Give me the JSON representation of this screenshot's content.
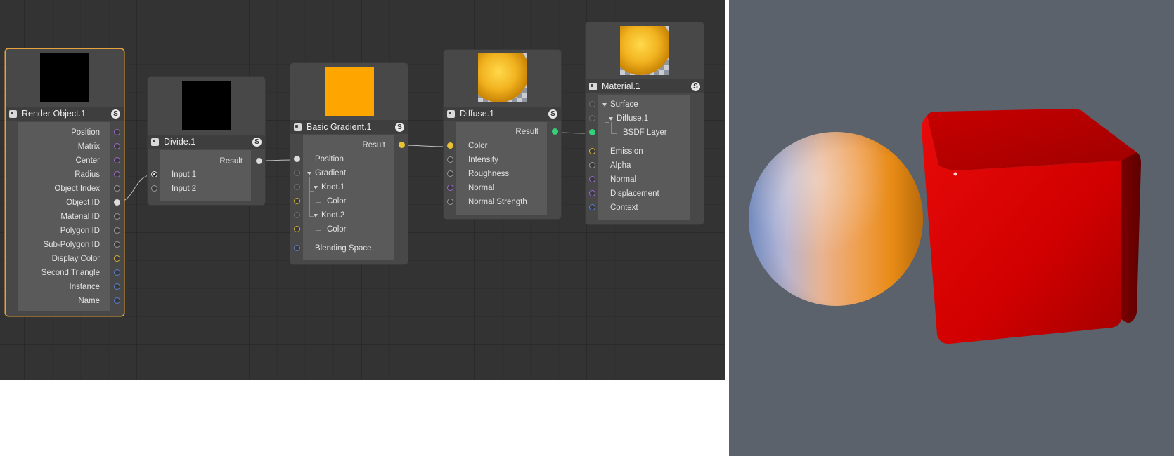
{
  "nodes": {
    "render_object": {
      "title": "Render Object.1",
      "solo": "S",
      "outputs": [
        "Position",
        "Matrix",
        "Center",
        "Radius",
        "Object Index",
        "Object ID",
        "Material ID",
        "Polygon ID",
        "Sub-Polygon ID",
        "Display Color",
        "Second Triangle",
        "Instance",
        "Name"
      ]
    },
    "divide": {
      "title": "Divide.1",
      "solo": "S",
      "result": "Result",
      "inputs": [
        "Input 1",
        "Input 2"
      ]
    },
    "basic_gradient": {
      "title": "Basic Gradient.1",
      "solo": "S",
      "result": "Result",
      "rows": [
        "Position",
        "Gradient",
        "Knot.1",
        "Color",
        "Knot.2",
        "Color",
        "Blending Space"
      ]
    },
    "diffuse": {
      "title": "Diffuse.1",
      "solo": "S",
      "result": "Result",
      "inputs": [
        "Color",
        "Intensity",
        "Roughness",
        "Normal",
        "Normal Strength"
      ]
    },
    "material": {
      "title": "Material.1",
      "solo": "S",
      "tree": [
        "Surface",
        "Diffuse.1",
        "BSDF Layer"
      ],
      "inputs": [
        "Emission",
        "Alpha",
        "Normal",
        "Displacement",
        "Context"
      ]
    }
  },
  "colors": {
    "editor_bg": "#333333",
    "viewport_bg": "#5b626b",
    "selection": "#e6a23c",
    "gradient_orange": "#ffa500",
    "cube_red": "#d10000"
  },
  "icons": [
    "node-type-icon",
    "solo-icon",
    "expand-triangle-icon"
  ]
}
